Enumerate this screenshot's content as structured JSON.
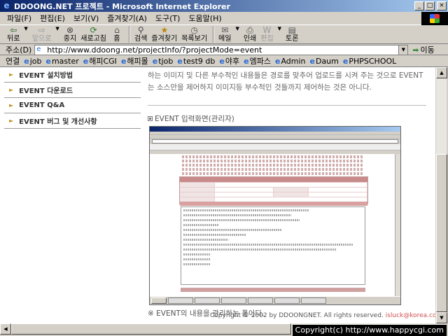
{
  "window": {
    "title": "DDOONG.NET 프로젝트 - Microsoft Internet Explorer",
    "min": "_",
    "max": "□",
    "close": "×"
  },
  "menu": [
    "파일(F)",
    "편집(E)",
    "보기(V)",
    "즐겨찾기(A)",
    "도구(T)",
    "도움말(H)"
  ],
  "toolbar": {
    "back": "뒤로",
    "forward": "앞으로",
    "stop": "중지",
    "refresh": "새로고침",
    "home": "홈",
    "search": "검색",
    "favorites": "즐겨찾기",
    "history": "목록보기",
    "mail": "메일",
    "print": "인쇄",
    "edit": "편집",
    "discuss": "토론"
  },
  "address": {
    "label": "주소(D)",
    "url": "http://www.ddoong.net/projectInfo/?projectMode=event",
    "go": "이동"
  },
  "links": {
    "label": "연결",
    "items": [
      "job",
      "master",
      "해피CGI",
      "해피몰",
      "tjob",
      "test9 db",
      "야후",
      "엠파스",
      "Admin",
      "Daum",
      "PHPSCHOOL"
    ]
  },
  "sidebar": {
    "items": [
      "EVENT 설치방법",
      "EVENT 다운로드",
      "EVENT Q&A",
      "EVENT 버그 및 개선사항"
    ]
  },
  "main": {
    "paragraph": "하는 이미지 및 다른 부수적인 내용들은 경로를 맞추어 업로드를 시켜 주는 것으로 EVENT는 소스만을 제어하지 이미지등 부수적인 것들까지 제어하는 것은 아니다.",
    "section_title": "EVENT 입력화면(관리자)",
    "note": "※ EVENT의 내용을 관리하는 폼이다.",
    "copyright": "Copyright © 2002 by DDOONGNET. All rights reserved.",
    "email": "isluck@korea.com"
  },
  "watermark": "Copyright(c) http://www.happycgi.com"
}
